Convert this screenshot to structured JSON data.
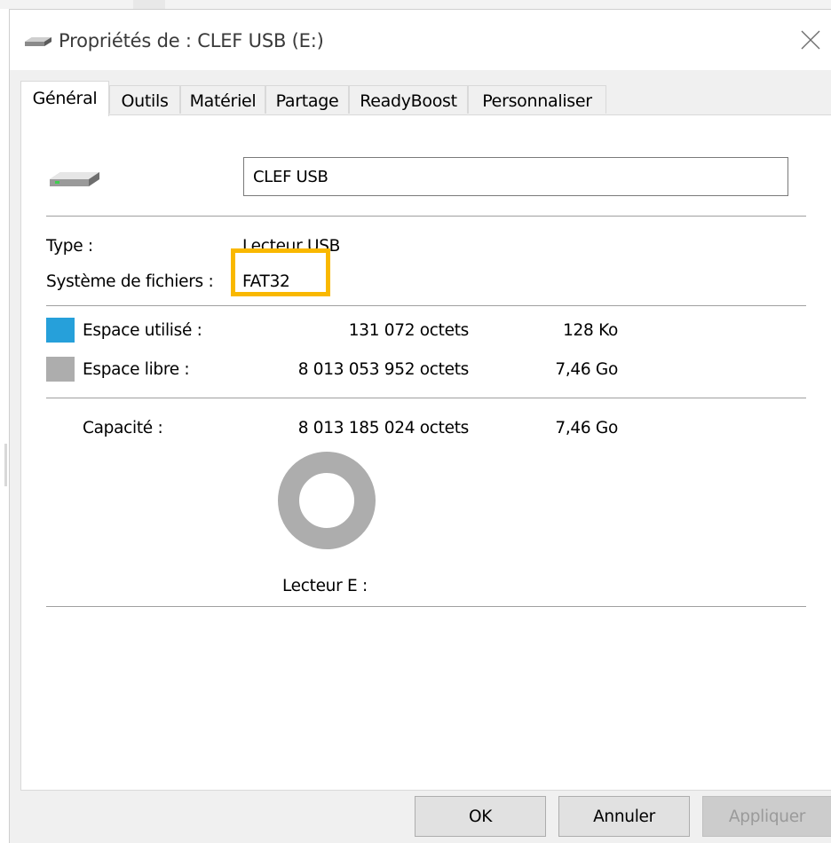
{
  "window": {
    "title": "Propriétés de : CLEF USB (E:)",
    "title_icon": "usb-drive-icon",
    "close_icon": "close-icon"
  },
  "tabs": [
    {
      "label": "Général",
      "active": true
    },
    {
      "label": "Outils",
      "active": false
    },
    {
      "label": "Matériel",
      "active": false
    },
    {
      "label": "Partage",
      "active": false
    },
    {
      "label": "ReadyBoost",
      "active": false
    },
    {
      "label": "Personnaliser",
      "active": false
    }
  ],
  "general": {
    "drive_icon": "usb-drive-icon",
    "name_value": "CLEF USB",
    "type_label": "Type :",
    "type_value": "Lecteur USB",
    "fs_label": "Système de fichiers :",
    "fs_value": "FAT32",
    "used": {
      "label": "Espace utilisé :",
      "bytes": "131 072 octets",
      "human": "128 Ko",
      "color": "#26a0da"
    },
    "free": {
      "label": "Espace libre :",
      "bytes": "8 013 053 952 octets",
      "human": "7,46 Go",
      "color": "#adadad"
    },
    "capacity": {
      "label": "Capacité :",
      "bytes": "8 013 185 024 octets",
      "human": "7,46 Go"
    },
    "drive_caption": "Lecteur E :",
    "highlight_color": "#f9b800"
  },
  "buttons": {
    "ok": "OK",
    "cancel": "Annuler",
    "apply": "Appliquer"
  }
}
